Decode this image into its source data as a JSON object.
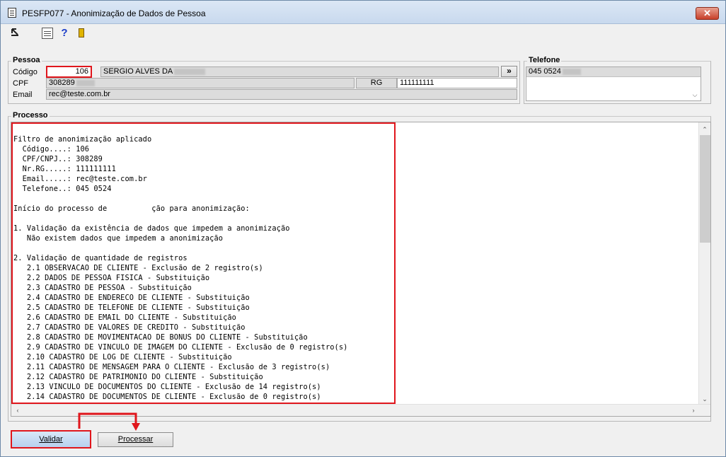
{
  "window": {
    "title": "PESFP077 - Anonimização de Dados de Pessoa",
    "close_label": "✕"
  },
  "toolbar": {
    "icons": [
      "arrow-icon",
      "calendar-icon",
      "help-icon",
      "exit-icon"
    ],
    "help_label": "?"
  },
  "pessoa": {
    "group_label": "Pessoa",
    "codigo_label": "Código",
    "codigo_value": "106",
    "nome_value": "SERGIO ALVES DA",
    "search_button_label": "»",
    "cpf_label": "CPF",
    "cpf_value": "308289",
    "rg_label": "RG",
    "rg_value": "111111111",
    "email_label": "Email",
    "email_value": "rec@teste.com.br"
  },
  "telefone": {
    "group_label": "Telefone",
    "value": "045 0524"
  },
  "processo": {
    "group_label": "Processo",
    "lines": [
      "Filtro de anonimização aplicado",
      "  Código....: 106",
      "  CPF/CNPJ..: 308289",
      "  Nr.RG.....: 111111111",
      "  Email.....: rec@teste.com.br",
      "  Telefone..: 045 0524",
      "",
      "Início do processo de          ção para anonimização:",
      "",
      "1. Validação da existência de dados que impedem a anonimização",
      "   Não existem dados que impedem a anonimização",
      "",
      "2. Validação de quantidade de registros",
      "   2.1 OBSERVACAO DE CLIENTE - Exclusão de 2 registro(s)",
      "   2.2 DADOS DE PESSOA FISICA - Substituição",
      "   2.3 CADASTRO DE PESSOA - Substituição",
      "   2.4 CADASTRO DE ENDERECO DE CLIENTE - Substituição",
      "   2.5 CADASTRO DE TELEFONE DE CLIENTE - Substituição",
      "   2.6 CADASTRO DE EMAIL DO CLIENTE - Substituição",
      "   2.7 CADASTRO DE VALORES DE CREDITO - Substituição",
      "   2.8 CADASTRO DE MOVIMENTACAO DE BONUS DO CLIENTE - Substituição",
      "   2.9 CADASTRO DE VINCULO DE IMAGEM DO CLIENTE - Exclusão de 0 registro(s)",
      "   2.10 CADASTRO DE LOG DE CLIENTE - Substituição",
      "   2.11 CADASTRO DE MENSAGEM PARA O CLIENTE - Exclusão de 3 registro(s)",
      "   2.12 CADASTRO DE PATRIMONIO DO CLIENTE - Substituição",
      "   2.13 VINCULO DE DOCUMENTOS DO CLIENTE - Exclusão de 14 registro(s)",
      "   2.14 CADASTRO DE DOCUMENTOS DE CLIENTE - Exclusão de 0 registro(s)"
    ]
  },
  "buttons": {
    "validar_label": "Validar",
    "processar_label": "Processar"
  },
  "colors": {
    "highlight": "#e0161c"
  }
}
